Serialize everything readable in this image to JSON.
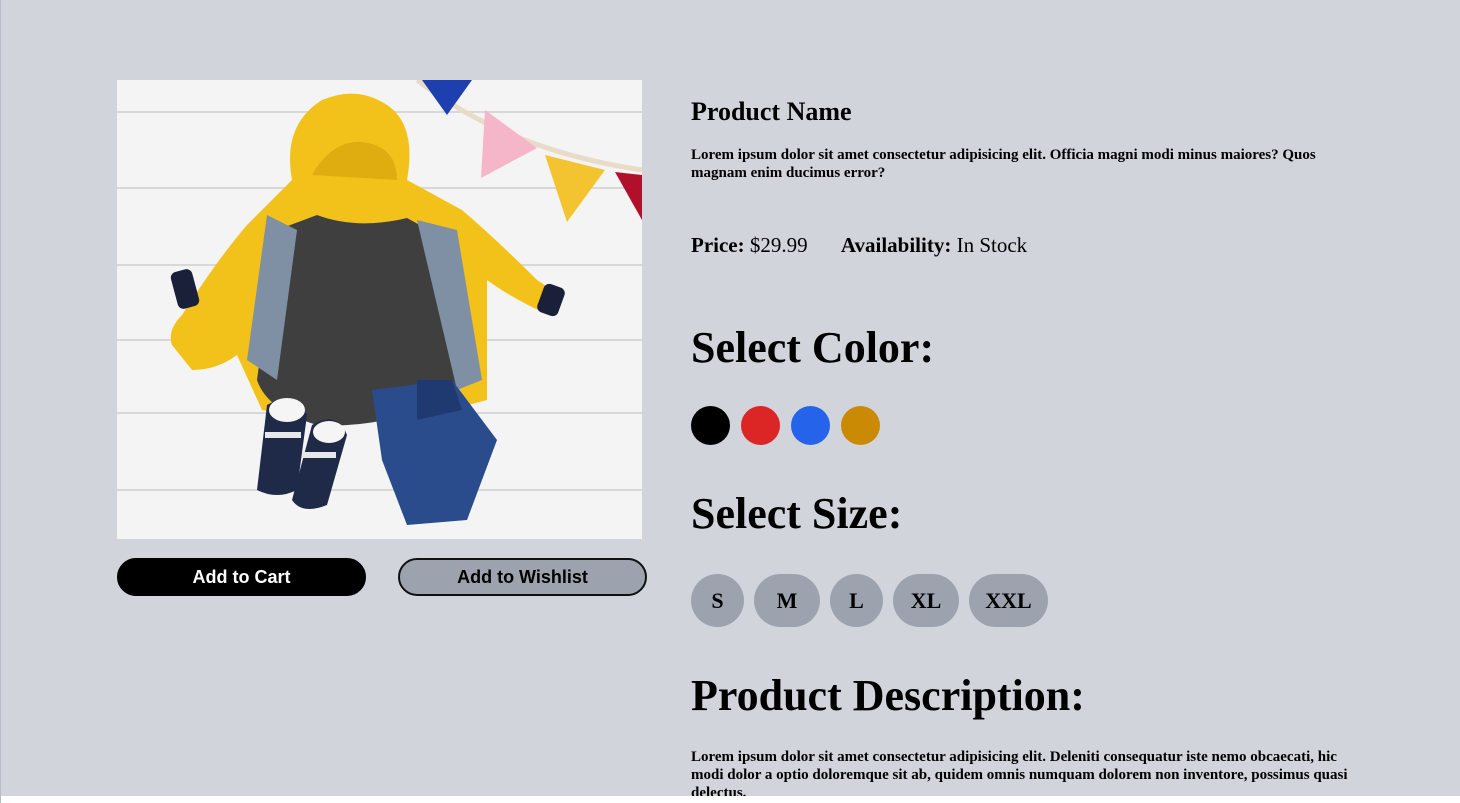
{
  "product": {
    "image_alt": "Kids outfit with yellow raincoat, grey t-shirt, jeans and sneakers",
    "name": "Product Name",
    "short_description": "Lorem ipsum dolor sit amet consectetur adipisicing elit. Officia magni modi minus maiores? Quos magnam enim ducimus error?",
    "price_label": "Price:",
    "price_value": "$29.99",
    "availability_label": "Availability:",
    "availability_value": "In Stock"
  },
  "actions": {
    "add_to_cart": "Add to Cart",
    "add_to_wishlist": "Add to Wishlist"
  },
  "color_section": {
    "heading": "Select Color:",
    "colors": [
      {
        "name": "black",
        "hex": "#000000"
      },
      {
        "name": "red",
        "hex": "#dc2626"
      },
      {
        "name": "blue",
        "hex": "#2563eb"
      },
      {
        "name": "gold",
        "hex": "#ca8a04"
      }
    ]
  },
  "size_section": {
    "heading": "Select Size:",
    "sizes": [
      "S",
      "M",
      "L",
      "XL",
      "XXL"
    ]
  },
  "description_section": {
    "heading": "Product Description:",
    "text": "Lorem ipsum dolor sit amet consectetur adipisicing elit. Deleniti consequatur iste nemo obcaecati, hic modi dolor a optio doloremque sit ab, quidem omnis numquam dolorem non inventore, possimus quasi delectus."
  },
  "theme": {
    "background": "#d1d5db",
    "button_primary": "#000000",
    "button_secondary": "#9ca3af"
  }
}
